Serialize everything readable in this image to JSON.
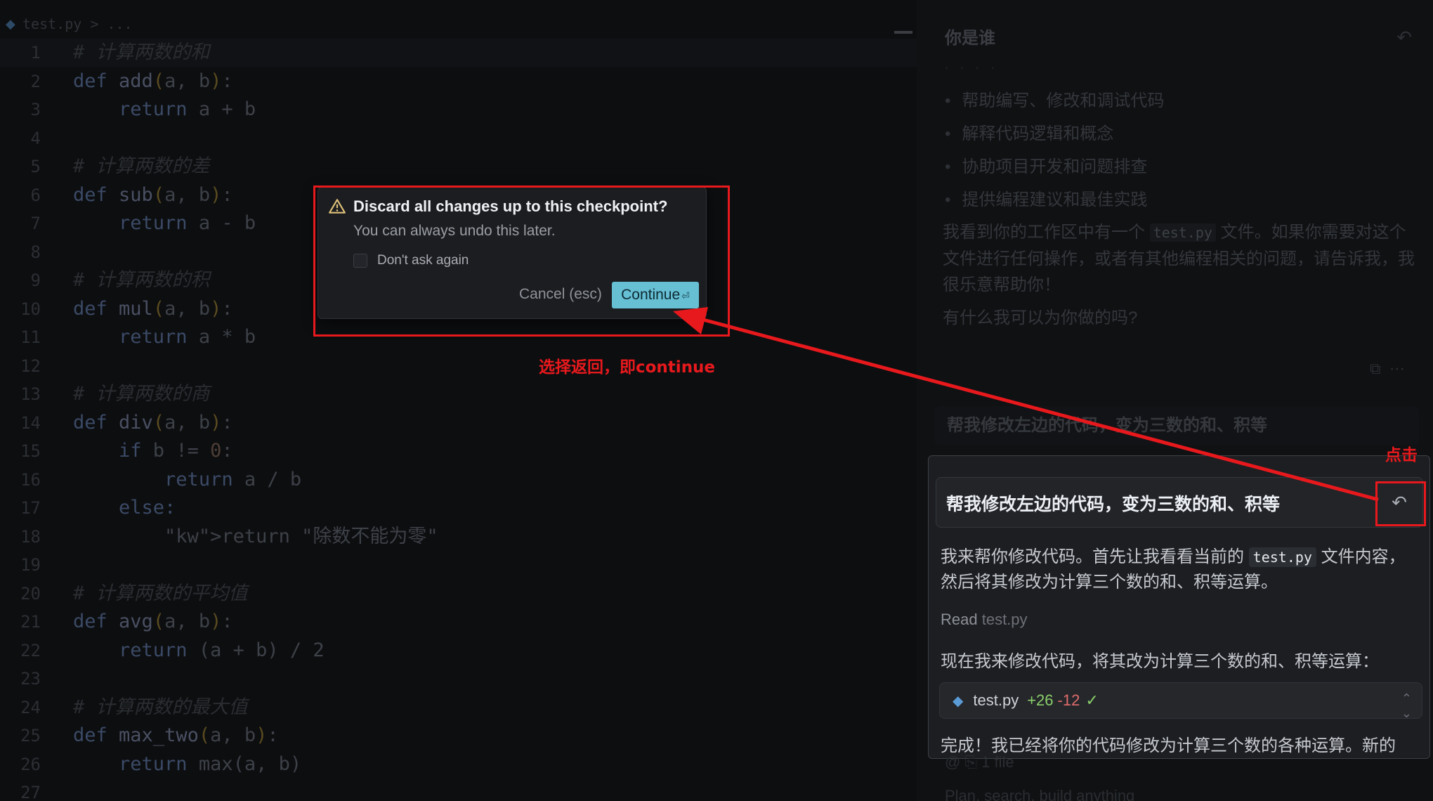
{
  "editor": {
    "breadcrumb": "test.py > ...",
    "lines": [
      {
        "n": "1",
        "kind": "comment",
        "text": "# 计算两数的和"
      },
      {
        "n": "2",
        "kind": "def",
        "name": "add",
        "params": "a, b"
      },
      {
        "n": "3",
        "kind": "ret",
        "text": "return a + b"
      },
      {
        "n": "4",
        "kind": "blank"
      },
      {
        "n": "5",
        "kind": "comment",
        "text": "# 计算两数的差"
      },
      {
        "n": "6",
        "kind": "def",
        "name": "sub",
        "params": "a, b"
      },
      {
        "n": "7",
        "kind": "ret",
        "text": "return a - b"
      },
      {
        "n": "8",
        "kind": "blank"
      },
      {
        "n": "9",
        "kind": "comment",
        "text": "# 计算两数的积"
      },
      {
        "n": "10",
        "kind": "def",
        "name": "mul",
        "params": "a, b"
      },
      {
        "n": "11",
        "kind": "ret",
        "text": "return a * b"
      },
      {
        "n": "12",
        "kind": "blank"
      },
      {
        "n": "13",
        "kind": "comment",
        "text": "# 计算两数的商"
      },
      {
        "n": "14",
        "kind": "def",
        "name": "div",
        "params": "a, b"
      },
      {
        "n": "15",
        "kind": "if",
        "text": "if b != 0:"
      },
      {
        "n": "16",
        "kind": "ret2",
        "text": "return a / b"
      },
      {
        "n": "17",
        "kind": "else",
        "text": "else:"
      },
      {
        "n": "18",
        "kind": "retstr",
        "text": "return \"除数不能为零\""
      },
      {
        "n": "19",
        "kind": "blank"
      },
      {
        "n": "20",
        "kind": "comment",
        "text": "# 计算两数的平均值"
      },
      {
        "n": "21",
        "kind": "def",
        "name": "avg",
        "params": "a, b"
      },
      {
        "n": "22",
        "kind": "ret",
        "text": "return (a + b) / 2"
      },
      {
        "n": "23",
        "kind": "blank"
      },
      {
        "n": "24",
        "kind": "comment",
        "text": "# 计算两数的最大值"
      },
      {
        "n": "25",
        "kind": "def",
        "name": "max_two",
        "params": "a, b"
      },
      {
        "n": "26",
        "kind": "ret",
        "text": "return max(a, b)"
      },
      {
        "n": "27",
        "kind": "blank"
      }
    ]
  },
  "chat": {
    "title": "你是谁",
    "bullets": [
      "帮助编写、修改和调试代码",
      "解释代码逻辑和概念",
      "协助项目开发和问题排查",
      "提供编程建议和最佳实践"
    ],
    "para1_pre": "我看到你的工作区中有一个 ",
    "para1_code": "test.py",
    "para1_post": " 文件。如果你需要对这个文件进行任何操作，或者有其他编程相关的问题，请告诉我，我很乐意帮助你！",
    "para2": "有什么我可以为你做的吗?",
    "prev_user_msg": "帮我修改左边的代码，变为三数的和、积等",
    "user_msg": "帮我修改左边的代码，变为三数的和、积等",
    "reply_pre": "我来帮你修改代码。首先让我看看当前的 ",
    "reply_code": "test.py",
    "reply_post": " 文件内容，然后将其修改为计算三个数的和、积等运算。",
    "read_label": "Read",
    "read_file": "test.py",
    "reply2": "现在我来修改代码，将其改为计算三个数的和、积等运算：",
    "file_card": {
      "name": "test.py",
      "added": "+26",
      "removed": "-12",
      "check": "✓"
    },
    "reply3": "完成！我已经将你的代码修改为计算三个数的各种运算。新的",
    "below_1": "@ ⎘ 1 file",
    "below_2": "Plan, search, build anything"
  },
  "dialog": {
    "title": "Discard all changes up to this checkpoint?",
    "subtitle": "You can always undo this later.",
    "checkbox_label": "Don't ask again",
    "cancel_label": "Cancel (esc)",
    "continue_label": "Continue",
    "continue_glyph": "⏎"
  },
  "annotations": {
    "click_label": "点击",
    "continue_note": "选择返回，即continue",
    "color": "#e8191d"
  },
  "icons": {
    "warning": "warning-icon",
    "restore": "undo-icon",
    "python": "python-icon"
  }
}
